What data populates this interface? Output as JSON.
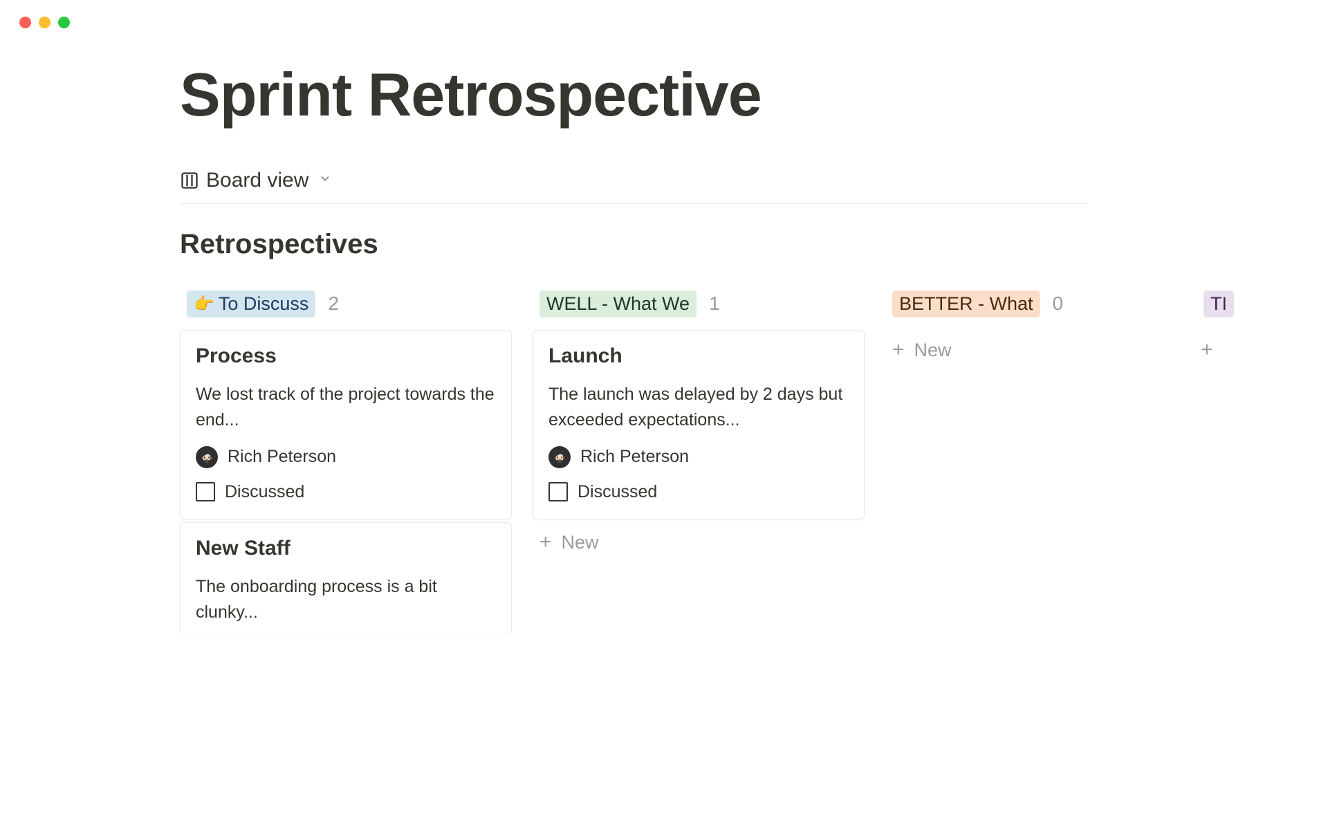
{
  "page": {
    "title": "Sprint Retrospective",
    "view_label": "Board view",
    "section_title": "Retrospectives"
  },
  "columns": [
    {
      "tag_emoji": "👉",
      "tag_label": "To Discuss",
      "tag_class": "tag-blue",
      "count": "2",
      "cards": [
        {
          "title": "Process",
          "body": "We lost track of the project towards the end...",
          "author": "Rich Peterson",
          "check_label": "Discussed"
        },
        {
          "title": "New Staff",
          "body": "The onboarding process is a bit clunky...",
          "author": "",
          "check_label": ""
        }
      ],
      "new_label": ""
    },
    {
      "tag_emoji": "",
      "tag_label": "WELL - What We",
      "tag_class": "tag-green",
      "count": "1",
      "cards": [
        {
          "title": "Launch",
          "body": "The launch was delayed by 2 days but exceeded expectations...",
          "author": "Rich Peterson",
          "check_label": "Discussed"
        }
      ],
      "new_label": "New"
    },
    {
      "tag_emoji": "",
      "tag_label": "BETTER - What",
      "tag_class": "tag-orange",
      "count": "0",
      "cards": [],
      "new_label": "New"
    },
    {
      "tag_emoji": "",
      "tag_label": "TI",
      "tag_class": "tag-purple",
      "count": "",
      "cards": [],
      "new_label": ""
    }
  ]
}
